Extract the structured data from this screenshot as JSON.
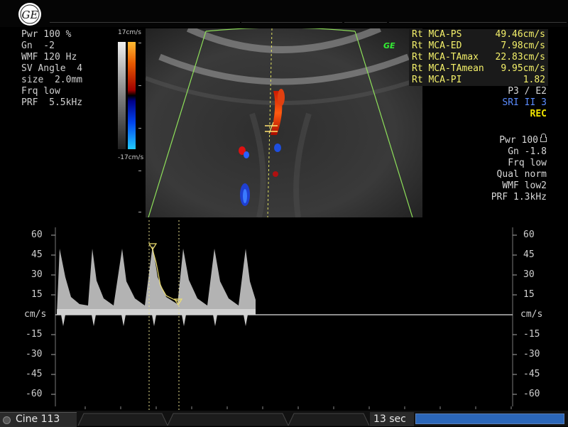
{
  "logo": {
    "icon": "ge-logo-icon"
  },
  "params_left": [
    "Pwr 100 %",
    "Gn  -2",
    "WMF 120 Hz",
    "SV Angle  4",
    "size  2.0mm",
    "Frq low",
    "PRF  5.5kHz"
  ],
  "colorbar": {
    "top_label": "17cm/s",
    "bottom_label": "-17cm/s"
  },
  "ge_badge": "GE",
  "measurements": [
    {
      "label": "Rt MCA-PS",
      "value": "49.46cm/s"
    },
    {
      "label": "Rt MCA-ED",
      "value": "7.98cm/s"
    },
    {
      "label": "Rt MCA-TAmax",
      "value": "22.83cm/s"
    },
    {
      "label": "Rt MCA-TAmean",
      "value": "9.95cm/s"
    },
    {
      "label": "Rt MCA-PI",
      "value": "1.82"
    }
  ],
  "right_info_1": {
    "probe": "P3 / E2",
    "sri": "SRI II 3",
    "rec": "REC"
  },
  "right_info_2": [
    "Pwr 100",
    "Gn -1.8",
    "Frq low",
    "Qual norm",
    "WMF low2",
    "PRF  1.3kHz"
  ],
  "doppler_axis": {
    "unit": "cm/s",
    "ticks": [
      "60",
      "45",
      "30",
      "15",
      "-15",
      "-30",
      "-45",
      "-60"
    ]
  },
  "bottom": {
    "cine_label": "Cine 113",
    "duration": "13 sec",
    "progress": 1.0
  },
  "colors": {
    "measure_text": "#f4f06a",
    "sri_text": "#5b8cff",
    "rec_text": "#f2e600",
    "ge_badge": "#33ee33",
    "progress": "#2b66b8"
  }
}
